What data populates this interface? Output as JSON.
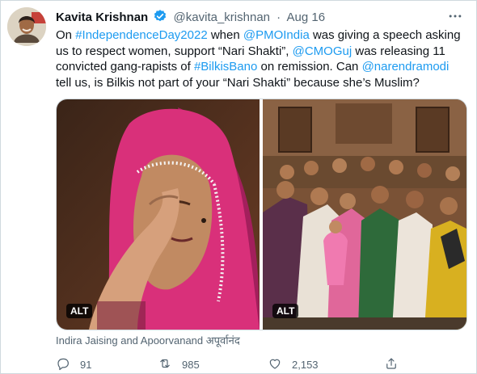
{
  "tweet": {
    "author_name": "Kavita Krishnan",
    "handle": "@kavita_krishnan",
    "separator": "·",
    "date": "Aug 16",
    "more_icon": "more-horizontal-icon",
    "text_parts": {
      "p1": "On ",
      "link1": "#IndependenceDay2022",
      "p2": " when ",
      "link2": "@PMOIndia",
      "p3": " was giving a speech asking us to respect women, support “Nari Shakti”, ",
      "link3": "@CMOGuj",
      "p4": " was releasing 11 convicted gang-rapists of ",
      "link4": "#BilkisBano",
      "p5": " on remission. Can ",
      "link5": "@narendramodi",
      "p6": " tell us, is Bilkis not part of your “Nari Shakti” because she’s Muslim?"
    },
    "media": {
      "left_alt_badge": "ALT",
      "right_alt_badge": "ALT"
    },
    "tagged_people": "Indira Jaising and Apoorvanand अपूर्वानंद",
    "actions": {
      "reply_count": "91",
      "retweet_count": "985",
      "like_count": "2,153"
    }
  },
  "colors": {
    "link": "#1d9bf0",
    "text": "#0f1419",
    "secondary": "#536471",
    "border": "#cfd9de",
    "verified": "#1d9bf0",
    "headscarf_pink": "#d9307a"
  }
}
